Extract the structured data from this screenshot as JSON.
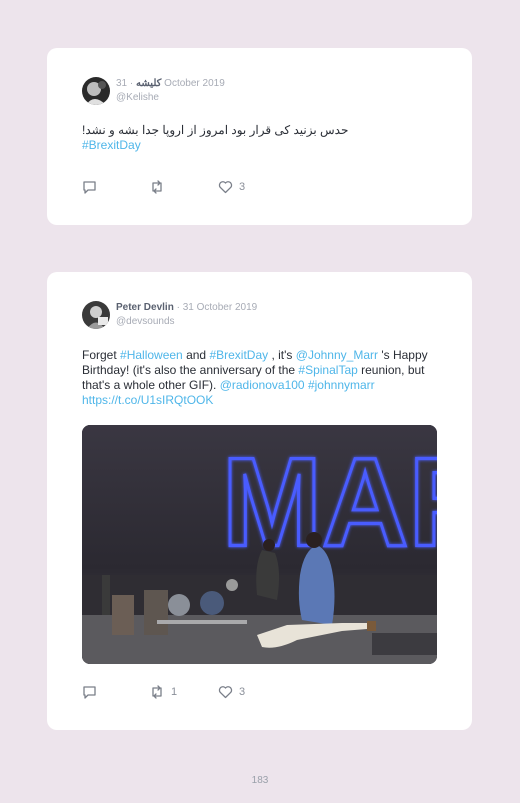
{
  "tweets": [
    {
      "author": "کلیشه",
      "date": "· 31 October 2019",
      "handle": "@Kelishe",
      "text": "حدس بزنید کی قرار بود امروز از اروپا جدا بشه و نشد!",
      "hashtag": "#BrexitDay",
      "reply_count": "",
      "retweet_count": "",
      "like_count": "3"
    },
    {
      "author": "Peter Devlin",
      "date": "· 31 October 2019",
      "handle": "@devsounds",
      "text_parts": {
        "p1": "Forget ",
        "tag1": "#Halloween",
        "p2": " and ",
        "tag2": "#BrexitDay",
        "p3": " , it's ",
        "mention1": "@Johnny_Marr",
        "p4": " 's Happy Birthday! (it's also the anniversary of the ",
        "tag3": "#SpinalTap",
        "p5": " reunion, but that's a whole other GIF). ",
        "mention2": "@radionova100",
        "p6": " ",
        "tag4": "#johnnymarr",
        "p7": " ",
        "url": "https://t.co/U1sIRQtOOK"
      },
      "media_sign_text": "MAR",
      "reply_count": "",
      "retweet_count": "1",
      "like_count": "3"
    }
  ],
  "page_number": "183",
  "colors": {
    "link": "#4fb6e9",
    "background": "#ede4ec",
    "card": "#ffffff"
  }
}
